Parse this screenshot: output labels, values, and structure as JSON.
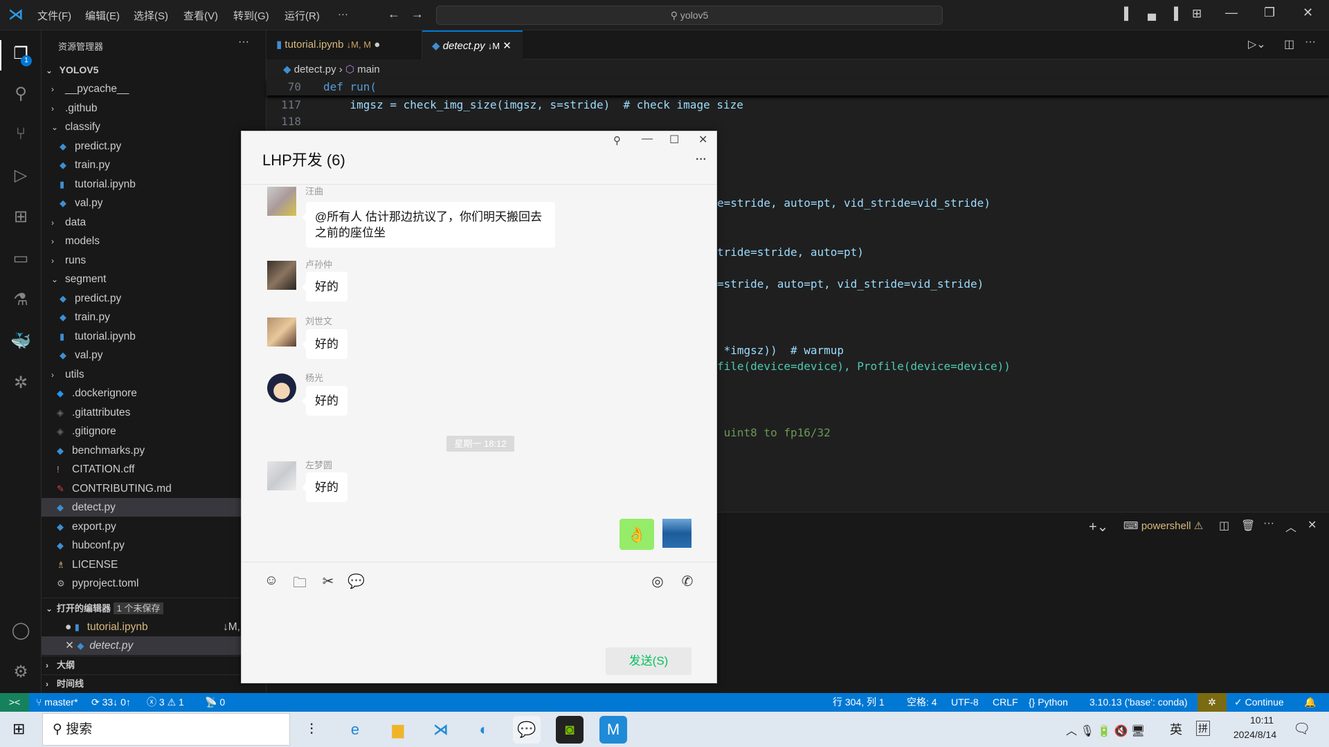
{
  "titlebar": {
    "menus": [
      "文件(F)",
      "编辑(E)",
      "选择(S)",
      "查看(V)",
      "转到(G)",
      "运行(R)",
      "···"
    ],
    "search": "yolov5"
  },
  "sidebar": {
    "title": "资源管理器",
    "root": "YOLOV5",
    "items": [
      {
        "label": "__pycache__",
        "type": "folder",
        "level": 0,
        "open": false
      },
      {
        "label": ".github",
        "type": "folder",
        "level": 0,
        "open": false
      },
      {
        "label": "classify",
        "type": "folder",
        "level": 0,
        "open": true
      },
      {
        "label": "predict.py",
        "type": "py",
        "level": 1
      },
      {
        "label": "train.py",
        "type": "py",
        "level": 1
      },
      {
        "label": "tutorial.ipynb",
        "type": "nb",
        "level": 1
      },
      {
        "label": "val.py",
        "type": "py",
        "level": 1
      },
      {
        "label": "data",
        "type": "folder",
        "level": 0,
        "open": false
      },
      {
        "label": "models",
        "type": "folder",
        "level": 0,
        "open": false
      },
      {
        "label": "runs",
        "type": "folder",
        "level": 0,
        "open": false
      },
      {
        "label": "segment",
        "type": "folder",
        "level": 0,
        "open": true
      },
      {
        "label": "predict.py",
        "type": "py",
        "level": 1
      },
      {
        "label": "train.py",
        "type": "py",
        "level": 1
      },
      {
        "label": "tutorial.ipynb",
        "type": "nb",
        "level": 1
      },
      {
        "label": "val.py",
        "type": "py",
        "level": 1
      },
      {
        "label": "utils",
        "type": "folder",
        "level": 0,
        "open": false
      },
      {
        "label": ".dockerignore",
        "type": "docker",
        "level": 0
      },
      {
        "label": ".gitattributes",
        "type": "git",
        "level": 0
      },
      {
        "label": ".gitignore",
        "type": "git",
        "level": 0
      },
      {
        "label": "benchmarks.py",
        "type": "py",
        "level": 0
      },
      {
        "label": "CITATION.cff",
        "type": "warn",
        "level": 0
      },
      {
        "label": "CONTRIBUTING.md",
        "type": "md",
        "level": 0
      },
      {
        "label": "detect.py",
        "type": "py",
        "level": 0,
        "selected": true
      },
      {
        "label": "export.py",
        "type": "py",
        "level": 0
      },
      {
        "label": "hubconf.py",
        "type": "py",
        "level": 0
      },
      {
        "label": "LICENSE",
        "type": "license",
        "level": 0
      },
      {
        "label": "pyproject.toml",
        "type": "gear",
        "level": 0
      }
    ],
    "open_editors": {
      "title": "打开的编辑器",
      "badge": "1 个未保存",
      "items": [
        {
          "label": "tutorial.ipynb",
          "status": "↓M,"
        },
        {
          "label": "detect.py",
          "status": ""
        }
      ]
    },
    "outline": "大纲",
    "timeline": "时间线"
  },
  "tabs": [
    {
      "label": "tutorial.ipynb",
      "status": "↓M, M"
    },
    {
      "label": "detect.py",
      "status": "↓M"
    }
  ],
  "breadcrumb": {
    "file": "detect.py",
    "symbol": "main"
  },
  "editor": {
    "lines": [
      {
        "num": "70",
        "text": "def run("
      },
      {
        "num": "117",
        "text": "    imgsz = check_img_size(imgsz, s=stride)  # check image size"
      },
      {
        "num": "118",
        "text": ""
      }
    ],
    "visible_fragments": [
      "e=stride, auto=pt, vid_stride=vid_stride)",
      "tride=stride, auto=pt)",
      "=stride, auto=pt, vid_stride=vid_stride)",
      " *imgsz))  # warmup",
      "file(device=device), Profile(device=device))",
      " uint8 to fp16/32"
    ]
  },
  "panel": {
    "terminal": "powershell"
  },
  "status": {
    "branch": "master*",
    "sync": "33↓ 0↑",
    "errors": "3",
    "warnings": "1",
    "ports": "0",
    "position": "行 304, 列 1",
    "spaces": "空格: 4",
    "encoding": "UTF-8",
    "eol": "CRLF",
    "language": "Python",
    "interpreter": "3.10.13 ('base': conda)",
    "continue": "✓ Continue"
  },
  "taskbar": {
    "search": "搜索",
    "time": "10:11",
    "date": "2024/8/14",
    "ime1": "英",
    "ime2": "拼"
  },
  "chat": {
    "title": "LHP开发 (6)",
    "messages": [
      {
        "sender": "汪曲",
        "text": "@所有人 估计那边抗议了，你们明天搬回去之前的座位坐"
      },
      {
        "sender": "卢孙仲",
        "text": "好的"
      },
      {
        "sender": "刘世文",
        "text": "好的"
      },
      {
        "sender": "杨光",
        "text": "好的"
      },
      {
        "sender": "左梦圆",
        "text": "好的"
      }
    ],
    "time_divider": "星期一 18:12",
    "self_message": "👌",
    "send": "发送(S)"
  },
  "colors": {
    "accent": "#0078d4",
    "wechat_green": "#95ec69",
    "send_text": "#07c160"
  }
}
